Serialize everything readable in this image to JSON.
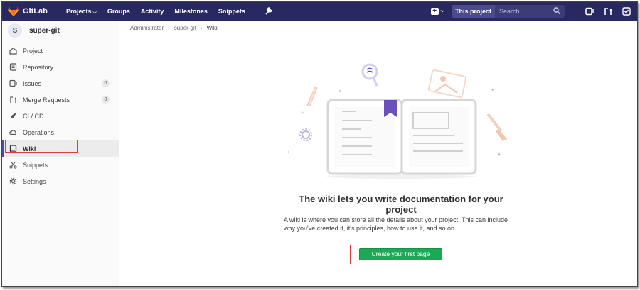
{
  "navbar": {
    "brand": "GitLab",
    "links": {
      "projects": "Projects",
      "groups": "Groups",
      "activity": "Activity",
      "milestones": "Milestones",
      "snippets": "Snippets"
    },
    "scope_label": "This project",
    "search_placeholder": "Search",
    "colors": {
      "background": "#292961",
      "brand_orange": "#e2432a"
    }
  },
  "project": {
    "avatar_letter": "S",
    "name": "super-git"
  },
  "sidebar": {
    "items": [
      {
        "label": "Project",
        "icon": "home-icon"
      },
      {
        "label": "Repository",
        "icon": "doc-icon"
      },
      {
        "label": "Issues",
        "icon": "issues-icon",
        "count": "0"
      },
      {
        "label": "Merge Requests",
        "icon": "merge-request-icon",
        "count": "0"
      },
      {
        "label": "CI / CD",
        "icon": "rocket-icon"
      },
      {
        "label": "Operations",
        "icon": "cloud-gear-icon"
      },
      {
        "label": "Wiki",
        "icon": "book-icon",
        "active": true
      },
      {
        "label": "Snippets",
        "icon": "scissors-icon"
      },
      {
        "label": "Settings",
        "icon": "gear-icon"
      }
    ]
  },
  "breadcrumb": {
    "root": "Administrator",
    "project": "super-git",
    "current": "Wiki"
  },
  "empty_state": {
    "title": "The wiki lets you write documentation for your project",
    "description": "A wiki is where you can store all the details about your project. This can include why you've created it, it's principles, how to use it, and so on.",
    "button_label": "Create your first page",
    "button_color": "#1aaa55"
  },
  "annotation_color": "#e53935"
}
